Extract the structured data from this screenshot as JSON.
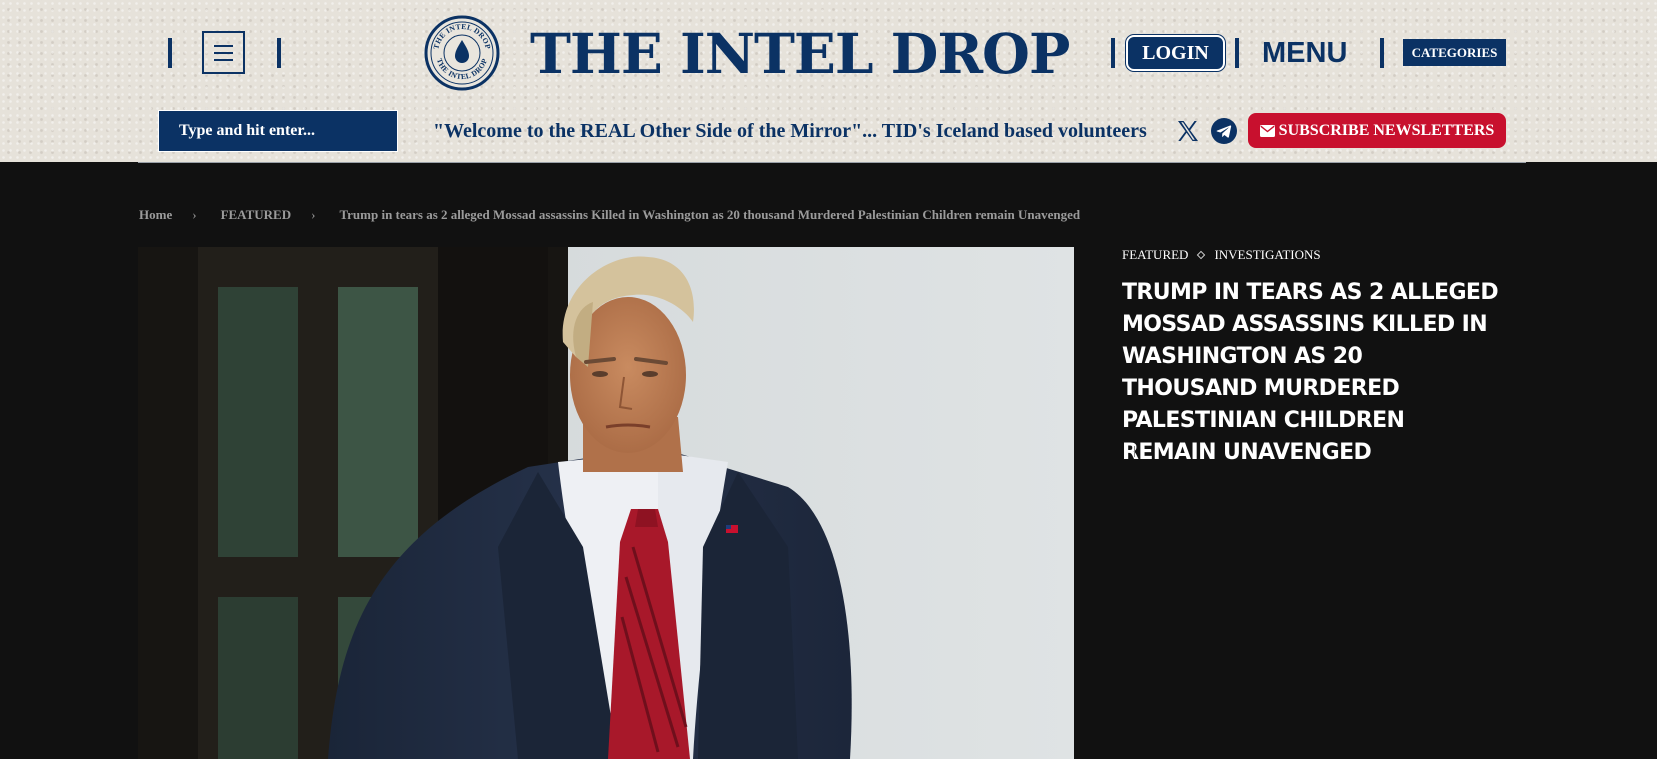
{
  "header": {
    "site_title": "THE INTEL DROP",
    "logo_text": "THE INTEL DROP",
    "login_label": "LOGIN",
    "menu_label": "MENU",
    "categories_label": "CATEGORIES",
    "search_placeholder": "Type and hit enter...",
    "ticker_text": "\"Welcome to the REAL Other Side of the Mirror\"... TID's Iceland based volunteers",
    "subscribe_label": "SUBSCRIBE NEWSLETTERS",
    "social_icons": [
      "x-icon",
      "telegram-icon"
    ],
    "colors": {
      "brand_navy": "#0b3264",
      "subscribe_red": "#c8102e"
    }
  },
  "breadcrumb": {
    "home": "Home",
    "section": "FEATURED",
    "current": "Trump in tears as 2 alleged Mossad assassins Killed in Washington as 20 thousand Murdered Palestinian Children remain Unavenged"
  },
  "article": {
    "categories": [
      "FEATURED",
      "INVESTIGATIONS"
    ],
    "headline": "Trump in tears as 2 alleged Mossad assassins Killed in Washington as 20 thousand Murdered Palestinian Children remain Unavenged"
  }
}
